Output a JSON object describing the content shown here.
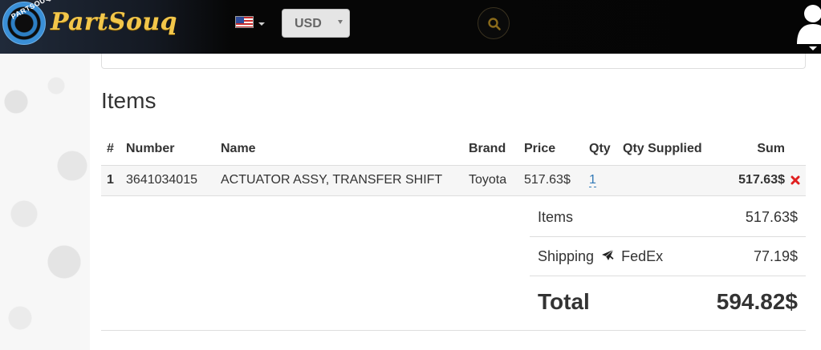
{
  "header": {
    "logo_text": "PartSouq",
    "logo_badge_text": "PARTSOUQ",
    "locale_icon": "us-flag-icon",
    "currency": {
      "selected": "USD"
    },
    "search_icon": "search-icon",
    "user_icon": "user-icon",
    "accent_color": "#f2c64a"
  },
  "items_section": {
    "title": "Items",
    "columns": [
      "#",
      "Number",
      "Name",
      "Brand",
      "Price",
      "Qty",
      "Qty Supplied",
      "Sum"
    ],
    "rows": [
      {
        "index": "1",
        "number": "3641034015",
        "name": "ACTUATOR ASSY, TRANSFER SHIFT",
        "brand": "Toyota",
        "price": "517.63$",
        "qty": "1",
        "qty_supplied": "",
        "sum": "517.63$"
      }
    ],
    "remove_icon": "remove-icon",
    "remove_color": "#e02020"
  },
  "summary": {
    "items_label": "Items",
    "items_value": "517.63$",
    "shipping_label": "Shipping",
    "shipping_carrier": "FedEx",
    "shipping_icon": "plane-icon",
    "shipping_value": "77.19$",
    "total_label": "Total",
    "total_value": "594.82$"
  }
}
